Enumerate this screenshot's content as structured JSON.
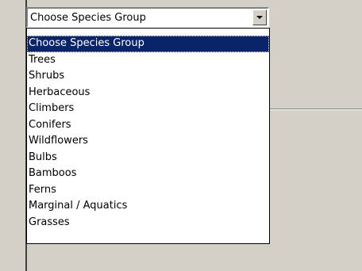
{
  "species_select": {
    "selected_value": "Choose Species Group",
    "options": [
      "Choose Species Group",
      "Trees",
      "Shrubs",
      "Herbaceous",
      "Climbers",
      "Conifers",
      "Wildflowers",
      "Bulbs",
      "Bamboos",
      "Ferns",
      "Marginal / Aquatics",
      "Grasses"
    ],
    "highlighted_index": 0
  },
  "icons": {
    "dropdown_arrow": "chevron-down-icon"
  },
  "colors": {
    "selection_background": "#0a246a",
    "selection_text": "#ffffff",
    "window_background": "#d4d0c8"
  }
}
